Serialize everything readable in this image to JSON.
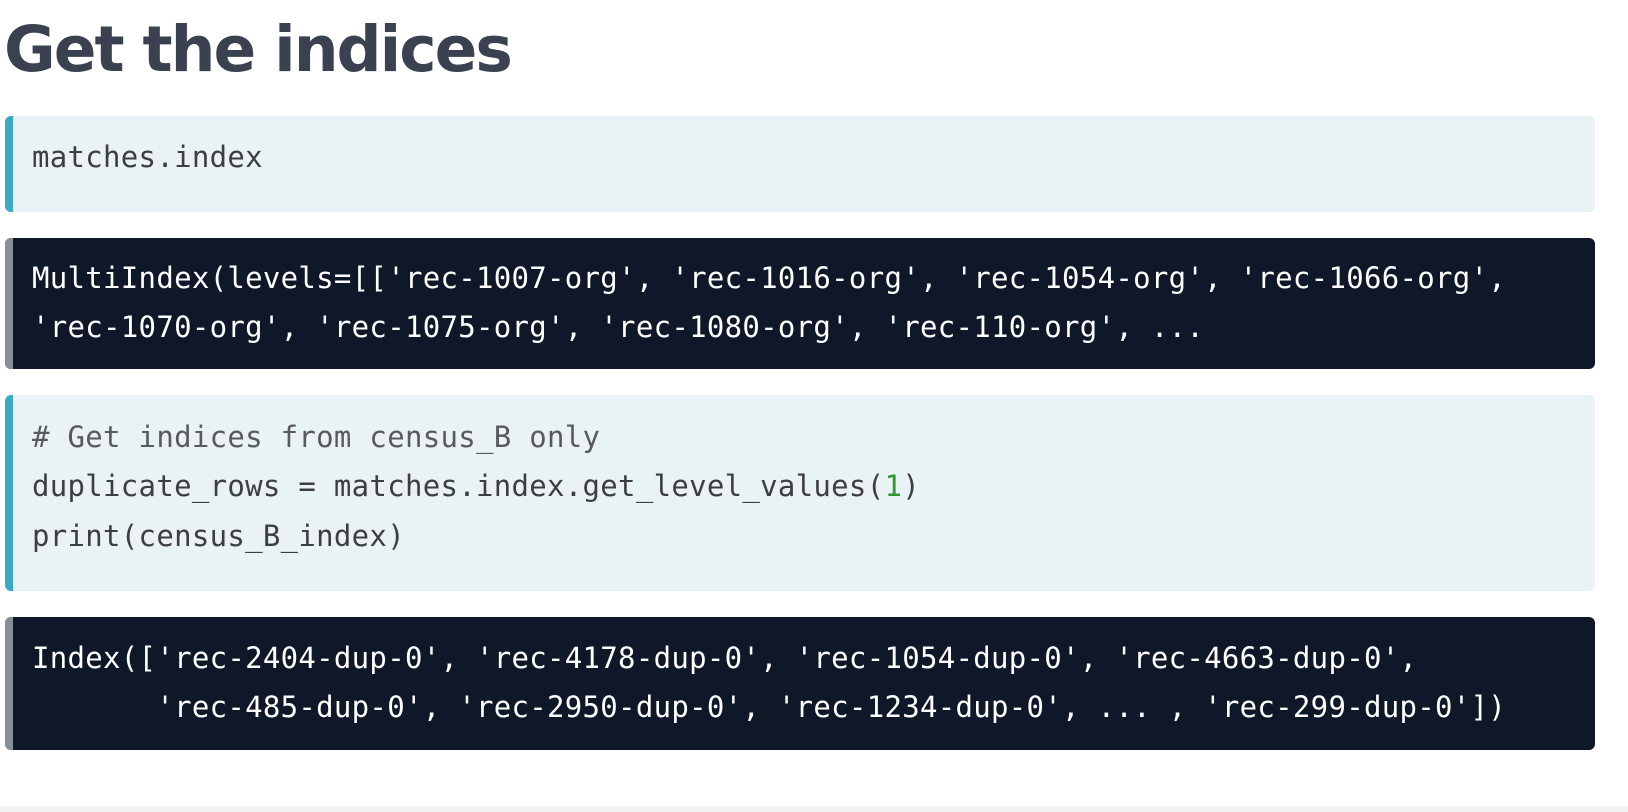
{
  "page": {
    "title": "Get the indices"
  },
  "blocks": {
    "code1": {
      "lines": [
        "matches.index"
      ]
    },
    "output1": {
      "lines": [
        "MultiIndex(levels=[['rec-1007-org', 'rec-1016-org', 'rec-1054-org', 'rec-1066-org',",
        "'rec-1070-org', 'rec-1075-org', 'rec-1080-org', 'rec-110-org', ..."
      ]
    },
    "code2": {
      "comment": "# Get indices from census_B only",
      "line2_prefix": "duplicate_rows = matches.index.get_level_values(",
      "line2_number": "1",
      "line2_suffix": ")",
      "line3": "print(census_B_index)"
    },
    "output2": {
      "lines": [
        "Index(['rec-2404-dup-0', 'rec-4178-dup-0', 'rec-1054-dup-0', 'rec-4663-dup-0',",
        "       'rec-485-dup-0', 'rec-2950-dup-0', 'rec-1234-dup-0', ... , 'rec-299-dup-0'])"
      ]
    }
  },
  "colors": {
    "code_background": "#e9f2f5",
    "code_accent": "#39a9c4",
    "output_background": "#0f1828",
    "output_accent": "#878f99",
    "number_literal": "#2f9a34",
    "title": "#3a4151"
  }
}
